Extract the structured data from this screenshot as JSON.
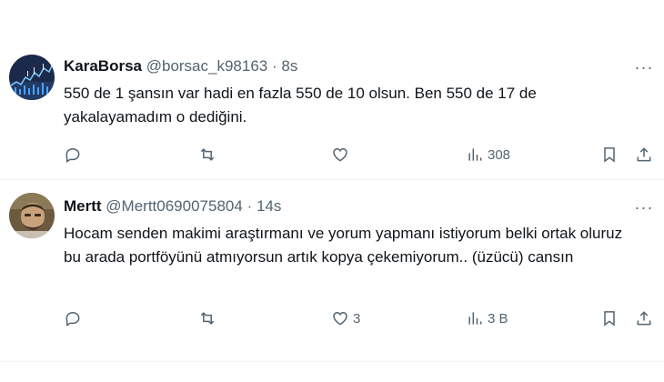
{
  "tweets": [
    {
      "display_name": "KaraBorsa",
      "handle": "@borsac_k98163",
      "separator": "·",
      "time": "8s",
      "text": "550 de 1 şansın var hadi en fazla 550 de 10 olsun. Ben 550 de 17 de yakalayamadım o dediğini.",
      "replies": "",
      "retweets": "",
      "likes": "",
      "views": "308"
    },
    {
      "display_name": "Mertt",
      "handle": "@Mertt0690075804",
      "separator": "·",
      "time": "14s",
      "text": "Hocam senden makimi araştırmanı ve yorum yapmanı istiyorum belki ortak oluruz bu arada portföyünü atmıyorsun artık kopya çekemiyorum.. (üzücü) cansın",
      "replies": "",
      "retweets": "",
      "likes": "3",
      "views": "3 B"
    }
  ],
  "more_label": "···"
}
